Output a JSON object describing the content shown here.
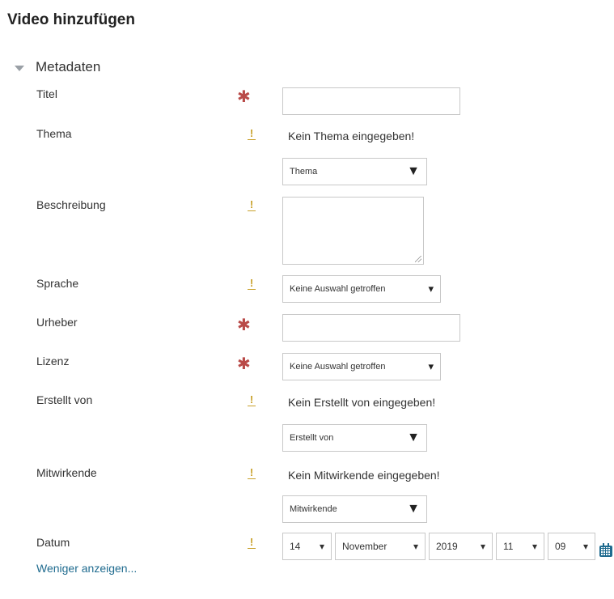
{
  "page": {
    "title": "Video hinzufügen"
  },
  "section": {
    "title": "Metadaten"
  },
  "fields": {
    "titel": {
      "label": "Titel",
      "value": ""
    },
    "thema": {
      "label": "Thema",
      "empty_message": "Kein Thema eingegeben!",
      "select": "Thema"
    },
    "beschreibung": {
      "label": "Beschreibung",
      "value": ""
    },
    "sprache": {
      "label": "Sprache",
      "select": "Keine Auswahl getroffen"
    },
    "urheber": {
      "label": "Urheber",
      "value": ""
    },
    "lizenz": {
      "label": "Lizenz",
      "select": "Keine Auswahl getroffen"
    },
    "erstellt_von": {
      "label": "Erstellt von",
      "empty_message": "Kein Erstellt von eingegeben!",
      "select": "Erstellt von"
    },
    "mitwirkende": {
      "label": "Mitwirkende",
      "empty_message": "Kein Mitwirkende eingegeben!",
      "select": "Mitwirkende"
    },
    "datum": {
      "label": "Datum",
      "day": "14",
      "month": "November",
      "year": "2019",
      "hour": "11",
      "minute": "09"
    }
  },
  "markers": {
    "required": "✱",
    "info": "!",
    "dropdown_arrow": "▼",
    "small_arrow": "▾"
  },
  "links": {
    "show_less": "Weniger anzeigen..."
  },
  "icons": {
    "caret": "caret-down-icon",
    "calendar": "calendar-icon"
  },
  "colors": {
    "required": "#b94a48",
    "info": "#c8a02a",
    "link": "#1f6b8f"
  }
}
